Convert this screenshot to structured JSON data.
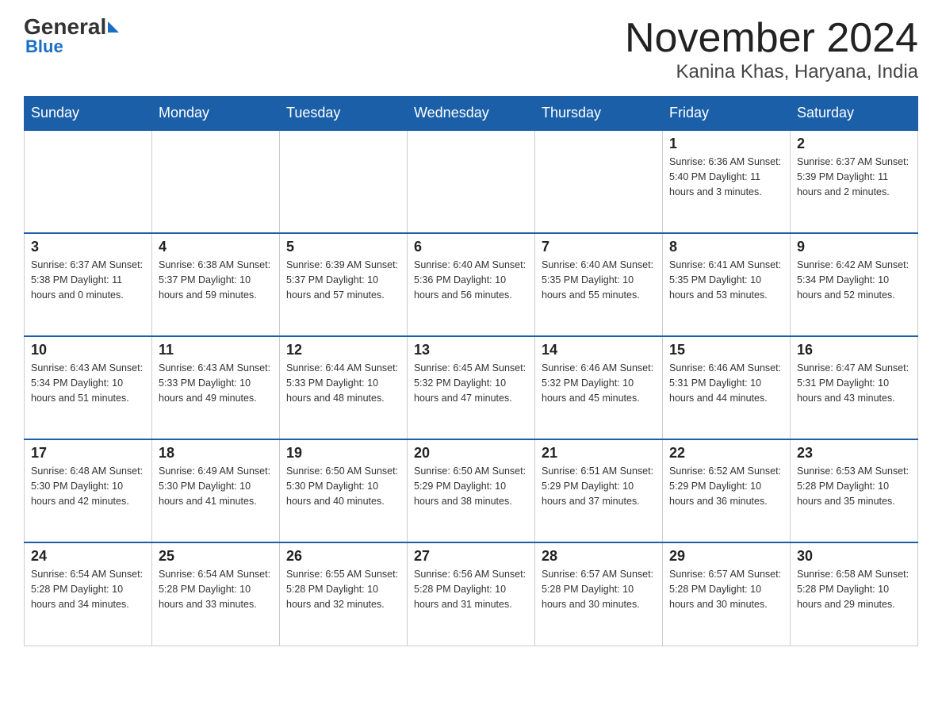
{
  "logo": {
    "general": "General",
    "blue": "Blue"
  },
  "title": {
    "month": "November 2024",
    "location": "Kanina Khas, Haryana, India"
  },
  "days_of_week": [
    "Sunday",
    "Monday",
    "Tuesday",
    "Wednesday",
    "Thursday",
    "Friday",
    "Saturday"
  ],
  "weeks": [
    [
      {
        "day": "",
        "info": ""
      },
      {
        "day": "",
        "info": ""
      },
      {
        "day": "",
        "info": ""
      },
      {
        "day": "",
        "info": ""
      },
      {
        "day": "",
        "info": ""
      },
      {
        "day": "1",
        "info": "Sunrise: 6:36 AM\nSunset: 5:40 PM\nDaylight: 11 hours and 3 minutes."
      },
      {
        "day": "2",
        "info": "Sunrise: 6:37 AM\nSunset: 5:39 PM\nDaylight: 11 hours and 2 minutes."
      }
    ],
    [
      {
        "day": "3",
        "info": "Sunrise: 6:37 AM\nSunset: 5:38 PM\nDaylight: 11 hours and 0 minutes."
      },
      {
        "day": "4",
        "info": "Sunrise: 6:38 AM\nSunset: 5:37 PM\nDaylight: 10 hours and 59 minutes."
      },
      {
        "day": "5",
        "info": "Sunrise: 6:39 AM\nSunset: 5:37 PM\nDaylight: 10 hours and 57 minutes."
      },
      {
        "day": "6",
        "info": "Sunrise: 6:40 AM\nSunset: 5:36 PM\nDaylight: 10 hours and 56 minutes."
      },
      {
        "day": "7",
        "info": "Sunrise: 6:40 AM\nSunset: 5:35 PM\nDaylight: 10 hours and 55 minutes."
      },
      {
        "day": "8",
        "info": "Sunrise: 6:41 AM\nSunset: 5:35 PM\nDaylight: 10 hours and 53 minutes."
      },
      {
        "day": "9",
        "info": "Sunrise: 6:42 AM\nSunset: 5:34 PM\nDaylight: 10 hours and 52 minutes."
      }
    ],
    [
      {
        "day": "10",
        "info": "Sunrise: 6:43 AM\nSunset: 5:34 PM\nDaylight: 10 hours and 51 minutes."
      },
      {
        "day": "11",
        "info": "Sunrise: 6:43 AM\nSunset: 5:33 PM\nDaylight: 10 hours and 49 minutes."
      },
      {
        "day": "12",
        "info": "Sunrise: 6:44 AM\nSunset: 5:33 PM\nDaylight: 10 hours and 48 minutes."
      },
      {
        "day": "13",
        "info": "Sunrise: 6:45 AM\nSunset: 5:32 PM\nDaylight: 10 hours and 47 minutes."
      },
      {
        "day": "14",
        "info": "Sunrise: 6:46 AM\nSunset: 5:32 PM\nDaylight: 10 hours and 45 minutes."
      },
      {
        "day": "15",
        "info": "Sunrise: 6:46 AM\nSunset: 5:31 PM\nDaylight: 10 hours and 44 minutes."
      },
      {
        "day": "16",
        "info": "Sunrise: 6:47 AM\nSunset: 5:31 PM\nDaylight: 10 hours and 43 minutes."
      }
    ],
    [
      {
        "day": "17",
        "info": "Sunrise: 6:48 AM\nSunset: 5:30 PM\nDaylight: 10 hours and 42 minutes."
      },
      {
        "day": "18",
        "info": "Sunrise: 6:49 AM\nSunset: 5:30 PM\nDaylight: 10 hours and 41 minutes."
      },
      {
        "day": "19",
        "info": "Sunrise: 6:50 AM\nSunset: 5:30 PM\nDaylight: 10 hours and 40 minutes."
      },
      {
        "day": "20",
        "info": "Sunrise: 6:50 AM\nSunset: 5:29 PM\nDaylight: 10 hours and 38 minutes."
      },
      {
        "day": "21",
        "info": "Sunrise: 6:51 AM\nSunset: 5:29 PM\nDaylight: 10 hours and 37 minutes."
      },
      {
        "day": "22",
        "info": "Sunrise: 6:52 AM\nSunset: 5:29 PM\nDaylight: 10 hours and 36 minutes."
      },
      {
        "day": "23",
        "info": "Sunrise: 6:53 AM\nSunset: 5:28 PM\nDaylight: 10 hours and 35 minutes."
      }
    ],
    [
      {
        "day": "24",
        "info": "Sunrise: 6:54 AM\nSunset: 5:28 PM\nDaylight: 10 hours and 34 minutes."
      },
      {
        "day": "25",
        "info": "Sunrise: 6:54 AM\nSunset: 5:28 PM\nDaylight: 10 hours and 33 minutes."
      },
      {
        "day": "26",
        "info": "Sunrise: 6:55 AM\nSunset: 5:28 PM\nDaylight: 10 hours and 32 minutes."
      },
      {
        "day": "27",
        "info": "Sunrise: 6:56 AM\nSunset: 5:28 PM\nDaylight: 10 hours and 31 minutes."
      },
      {
        "day": "28",
        "info": "Sunrise: 6:57 AM\nSunset: 5:28 PM\nDaylight: 10 hours and 30 minutes."
      },
      {
        "day": "29",
        "info": "Sunrise: 6:57 AM\nSunset: 5:28 PM\nDaylight: 10 hours and 30 minutes."
      },
      {
        "day": "30",
        "info": "Sunrise: 6:58 AM\nSunset: 5:28 PM\nDaylight: 10 hours and 29 minutes."
      }
    ]
  ]
}
